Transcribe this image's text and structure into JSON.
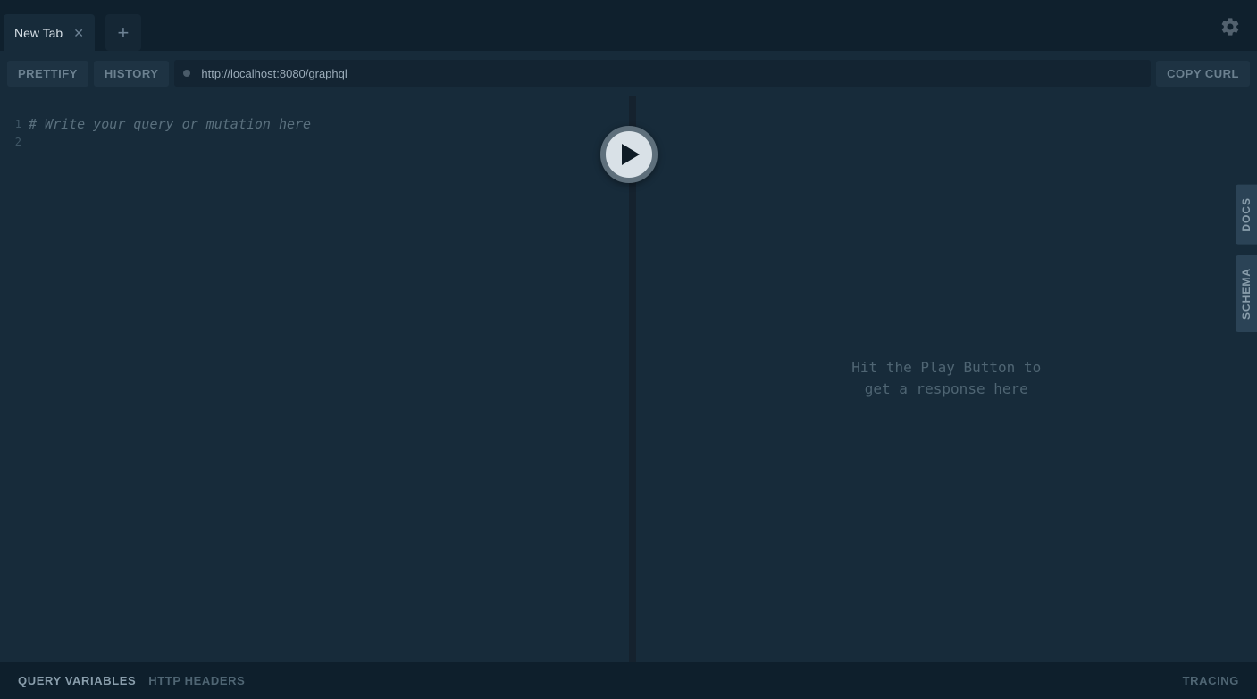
{
  "tabs": {
    "items": [
      {
        "label": "New Tab"
      }
    ]
  },
  "toolbar": {
    "prettify_label": "PRETTIFY",
    "history_label": "HISTORY",
    "copy_curl_label": "COPY CURL",
    "url": "http://localhost:8080/graphql"
  },
  "editor": {
    "lines": {
      "l1_num": "1",
      "l2_num": "2",
      "l1_text": "# Write your query or mutation here"
    }
  },
  "response": {
    "placeholder_line1": "Hit the Play Button to",
    "placeholder_line2": "get a response here"
  },
  "side_panels": {
    "docs_label": "DOCS",
    "schema_label": "SCHEMA"
  },
  "bottom": {
    "query_vars_label": "QUERY VARIABLES",
    "http_headers_label": "HTTP HEADERS",
    "tracing_label": "TRACING"
  }
}
